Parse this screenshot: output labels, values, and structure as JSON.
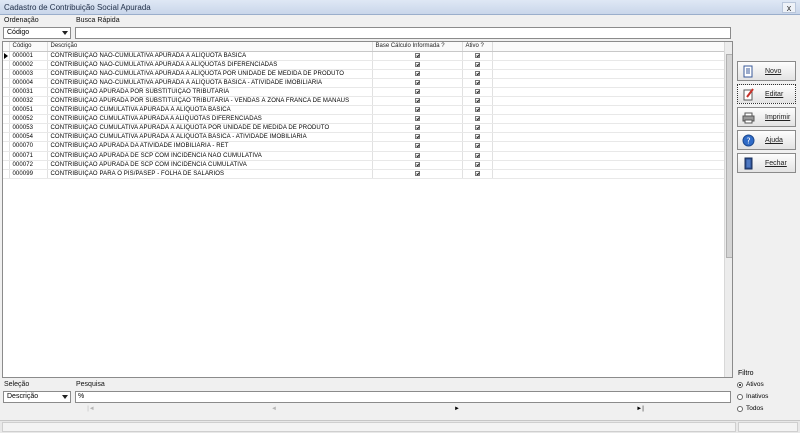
{
  "window": {
    "title": "Cadastro de Contribuição Social Apurada",
    "close_label": "x"
  },
  "top": {
    "ordering_label": "Ordenação",
    "ordering_value": "Código",
    "quick_search_label": "Busca Rápida",
    "quick_search_value": ""
  },
  "grid": {
    "columns": [
      "Código",
      "Descrição",
      "Base Cálculo Informada ?",
      "Ativo ?"
    ],
    "rows": [
      {
        "code": "000001",
        "desc": "CONTRIBUIÇÃO NÃO-CUMULATIVA APURADA À ALÍQUOTA BÁSICA",
        "base": true,
        "ativo": true
      },
      {
        "code": "000002",
        "desc": "CONTRIBUIÇÃO NÃO-CUMULATIVA APURADA A ALÍQUOTAS DIFERENCIADAS",
        "base": true,
        "ativo": true
      },
      {
        "code": "000003",
        "desc": "CONTRIBUIÇÃO NÃO-CUMULATIVA APURADA A ALÍQUOTA POR UNIDADE DE MEDIDA DE PRODUTO",
        "base": true,
        "ativo": true
      },
      {
        "code": "000004",
        "desc": "CONTRIBUIÇÃO NÃO-CUMULATIVA APURADA À ALÍQUOTA BÁSICA - ATIVIDADE IMOBILIÁRIA",
        "base": true,
        "ativo": true
      },
      {
        "code": "000031",
        "desc": "CONTRIBUIÇÃO APURADA POR SUBSTITUIÇÃO TRIBUTÁRIA",
        "base": true,
        "ativo": true
      },
      {
        "code": "000032",
        "desc": "CONTRIBUIÇÃO APURADA POR SUBSTITUIÇÃO TRIBUTÁRIA - VENDAS À ZONA FRANCA DE MANAUS",
        "base": true,
        "ativo": true
      },
      {
        "code": "000051",
        "desc": "CONTRIBUIÇÃO CUMULATIVA APURADA À ALÍQUOTA BÁSICA",
        "base": true,
        "ativo": true
      },
      {
        "code": "000052",
        "desc": "CONTRIBUIÇÃO CUMULATIVA APURADA A ALÍQUOTAS DIFERENCIADAS",
        "base": true,
        "ativo": true
      },
      {
        "code": "000053",
        "desc": "CONTRIBUIÇÃO CUMULATIVA APURADA À ALÍQUOTA POR UNIDADE DE MEDIDA DE PRODUTO",
        "base": true,
        "ativo": true
      },
      {
        "code": "000054",
        "desc": "CONTRIBUIÇÃO CUMULATIVA APURADA À ALÍQUOTA BÁSICA - ATIVIDADE IMOBILIÁRIA",
        "base": true,
        "ativo": true
      },
      {
        "code": "000070",
        "desc": "CONTRIBUIÇÃO APURADA DA ATIVIDADE IMOBILIÁRIA - RET",
        "base": true,
        "ativo": true
      },
      {
        "code": "000071",
        "desc": "CONTRIBUIÇÃO APURADA DE SCP COM INCIDÊNCIA NÃO CUMULATIVA",
        "base": true,
        "ativo": true
      },
      {
        "code": "000072",
        "desc": "CONTRIBUIÇÃO APURADA DE SCP COM INCIDÊNCIA CUMULATIVA",
        "base": true,
        "ativo": true
      },
      {
        "code": "000099",
        "desc": "CONTRIBUIÇÃO PARA O PIS/PASEP - FOLHA DE SALÁRIOS",
        "base": true,
        "ativo": true
      }
    ]
  },
  "side_buttons": {
    "novo": "Novo",
    "editar": "Editar",
    "imprimir": "Imprimir",
    "ajuda": "Ajuda",
    "fechar": "Fechar"
  },
  "bottom": {
    "selection_label": "Seleção",
    "selection_value": "Descrição",
    "search_label": "Pesquisa",
    "search_value": "%"
  },
  "filter": {
    "title": "Filtro",
    "options": [
      {
        "label": "Ativos",
        "selected": true
      },
      {
        "label": "Inativos",
        "selected": false
      },
      {
        "label": "Todos",
        "selected": false
      }
    ]
  },
  "navigator": {
    "first": "|◄",
    "prev": "◄",
    "next": "►",
    "last": "►|"
  }
}
